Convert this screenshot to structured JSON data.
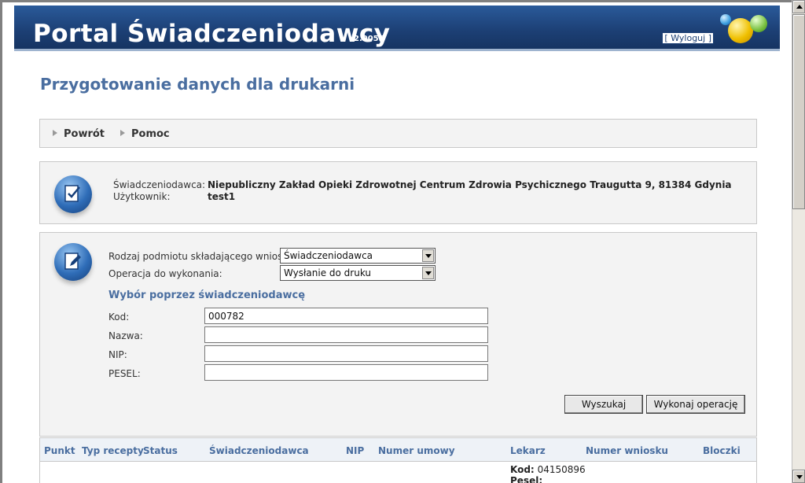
{
  "header": {
    "title": "Portal Świadczeniodawcy",
    "version": "2.0055",
    "logout_label": "[ Wyloguj ]"
  },
  "page": {
    "title": "Przygotowanie danych dla drukarni"
  },
  "nav": {
    "back_label": "Powrót",
    "help_label": "Pomoc"
  },
  "info": {
    "provider_label": "Świadczeniodawca:",
    "provider_value": "Niepubliczny Zakład Opieki Zdrowotnej Centrum Zdrowia Psychicznego Traugutta 9, 81384 Gdynia",
    "user_label": "Użytkownik:",
    "user_value": "test1"
  },
  "form": {
    "entity_type_label": "Rodzaj podmiotu składającego wniosek:",
    "entity_type_value": "Świadczeniodawca",
    "operation_label": "Operacja do wykonania:",
    "operation_value": "Wysłanie do druku",
    "section_title": "Wybór poprzez świadczeniodawcę",
    "kod_label": "Kod:",
    "kod_value": "000782",
    "nazwa_label": "Nazwa:",
    "nazwa_value": "",
    "nip_label": "NIP:",
    "nip_value": "",
    "pesel_label": "PESEL:",
    "pesel_value": "",
    "search_button": "Wyszukaj",
    "execute_button": "Wykonaj operację"
  },
  "table": {
    "columns": [
      "Punkt",
      "Typ recepty",
      "Status",
      "Świadczeniodawca",
      "NIP",
      "Numer umowy",
      "Lekarz",
      "Numer wniosku",
      "Bloczki"
    ],
    "row": {
      "kod_label": "Kod:",
      "kod_value": "04150896",
      "pesel_label": "Pesel:"
    }
  },
  "colors": {
    "header_blue": "#1c3f74",
    "title_blue": "#4a6ea0",
    "panel_bg": "#f3f3f3"
  }
}
